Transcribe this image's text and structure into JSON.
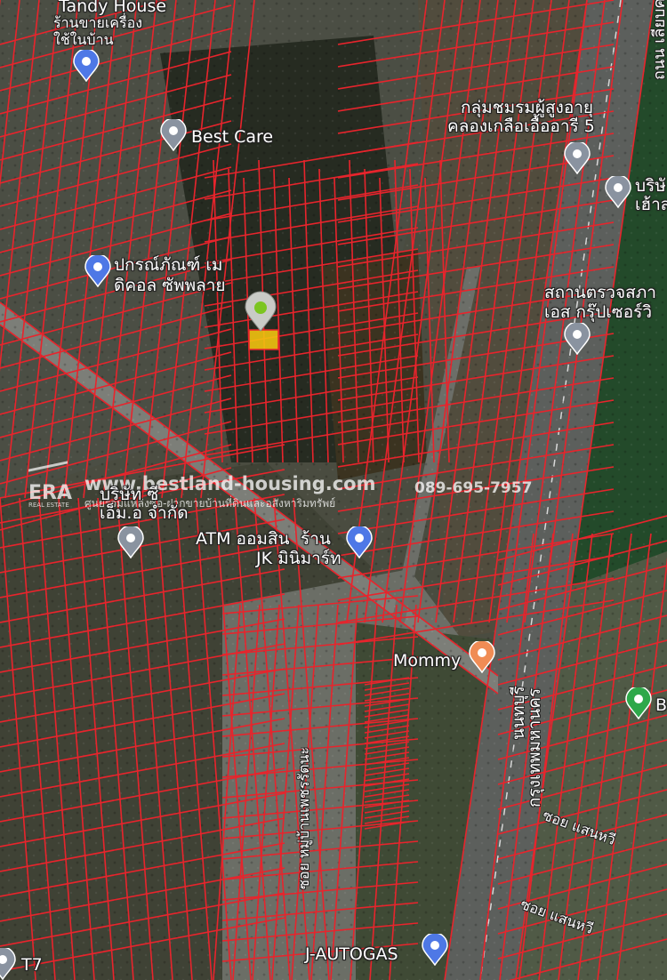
{
  "colors": {
    "parcel_line": "#e8242c",
    "selected_parcel": "#f2c20f",
    "pin_gray": "#8a93a0",
    "pin_blue": "#4e78e6",
    "pin_orange": "#f08c55",
    "pin_green": "#2ea84a",
    "marker_green": "#7cc520"
  },
  "places": {
    "tandy_house": "Tandy House",
    "tandy_house_sub1": "ร้านขายเครื่อง",
    "tandy_house_sub2": "ใช้ในบ้าน",
    "best_care": "Best Care",
    "elderly_club1": "กลุ่มชมรมผู้สูงอายุ",
    "elderly_club2": "คลองเกลือเอื้ออารี 5",
    "company_right": "บริษั",
    "company_right2": "เฮ้าส",
    "medical1": "ปกรณ์ภัณฑ์ เม",
    "medical2": "ดิคอล ซัพพลาย",
    "station1": "สถานตรวจสภา",
    "station2": "เอส กรุ๊ปเซอร์วิ",
    "company_left1": "บริษัท ซี",
    "company_left2": "เอ็ม.อ จำกัด",
    "atm": "ATM ออมสิน",
    "jk1": "ร้าน",
    "jk2": "JK มินิมาร์ท",
    "mommy": "Mommy",
    "right_b": "B",
    "autogas": "J-AUTOGAS",
    "t7": "T7"
  },
  "roads": {
    "top_right": "ถนน เลียบคลอง",
    "highway1": "นนทบุรี",
    "highway2": "กรุงเทพมหานคร",
    "soi_village": "ซอย หมู่บ้านเพชรรัตนะ",
    "soi_saen1": "ซอย แสนหวี",
    "soi_saen2": "ซอย แสนหวี"
  },
  "watermark": {
    "logo": "ERA",
    "logo_sub": "REAL ESTATE",
    "site": "www.bestland-housing.com",
    "tagline": "ศูนย์รวมแหล่งซื้อ-ฝากขายบ้านที่ดินและอสังหาริมทรัพย์",
    "phone": "089-695-7957"
  }
}
